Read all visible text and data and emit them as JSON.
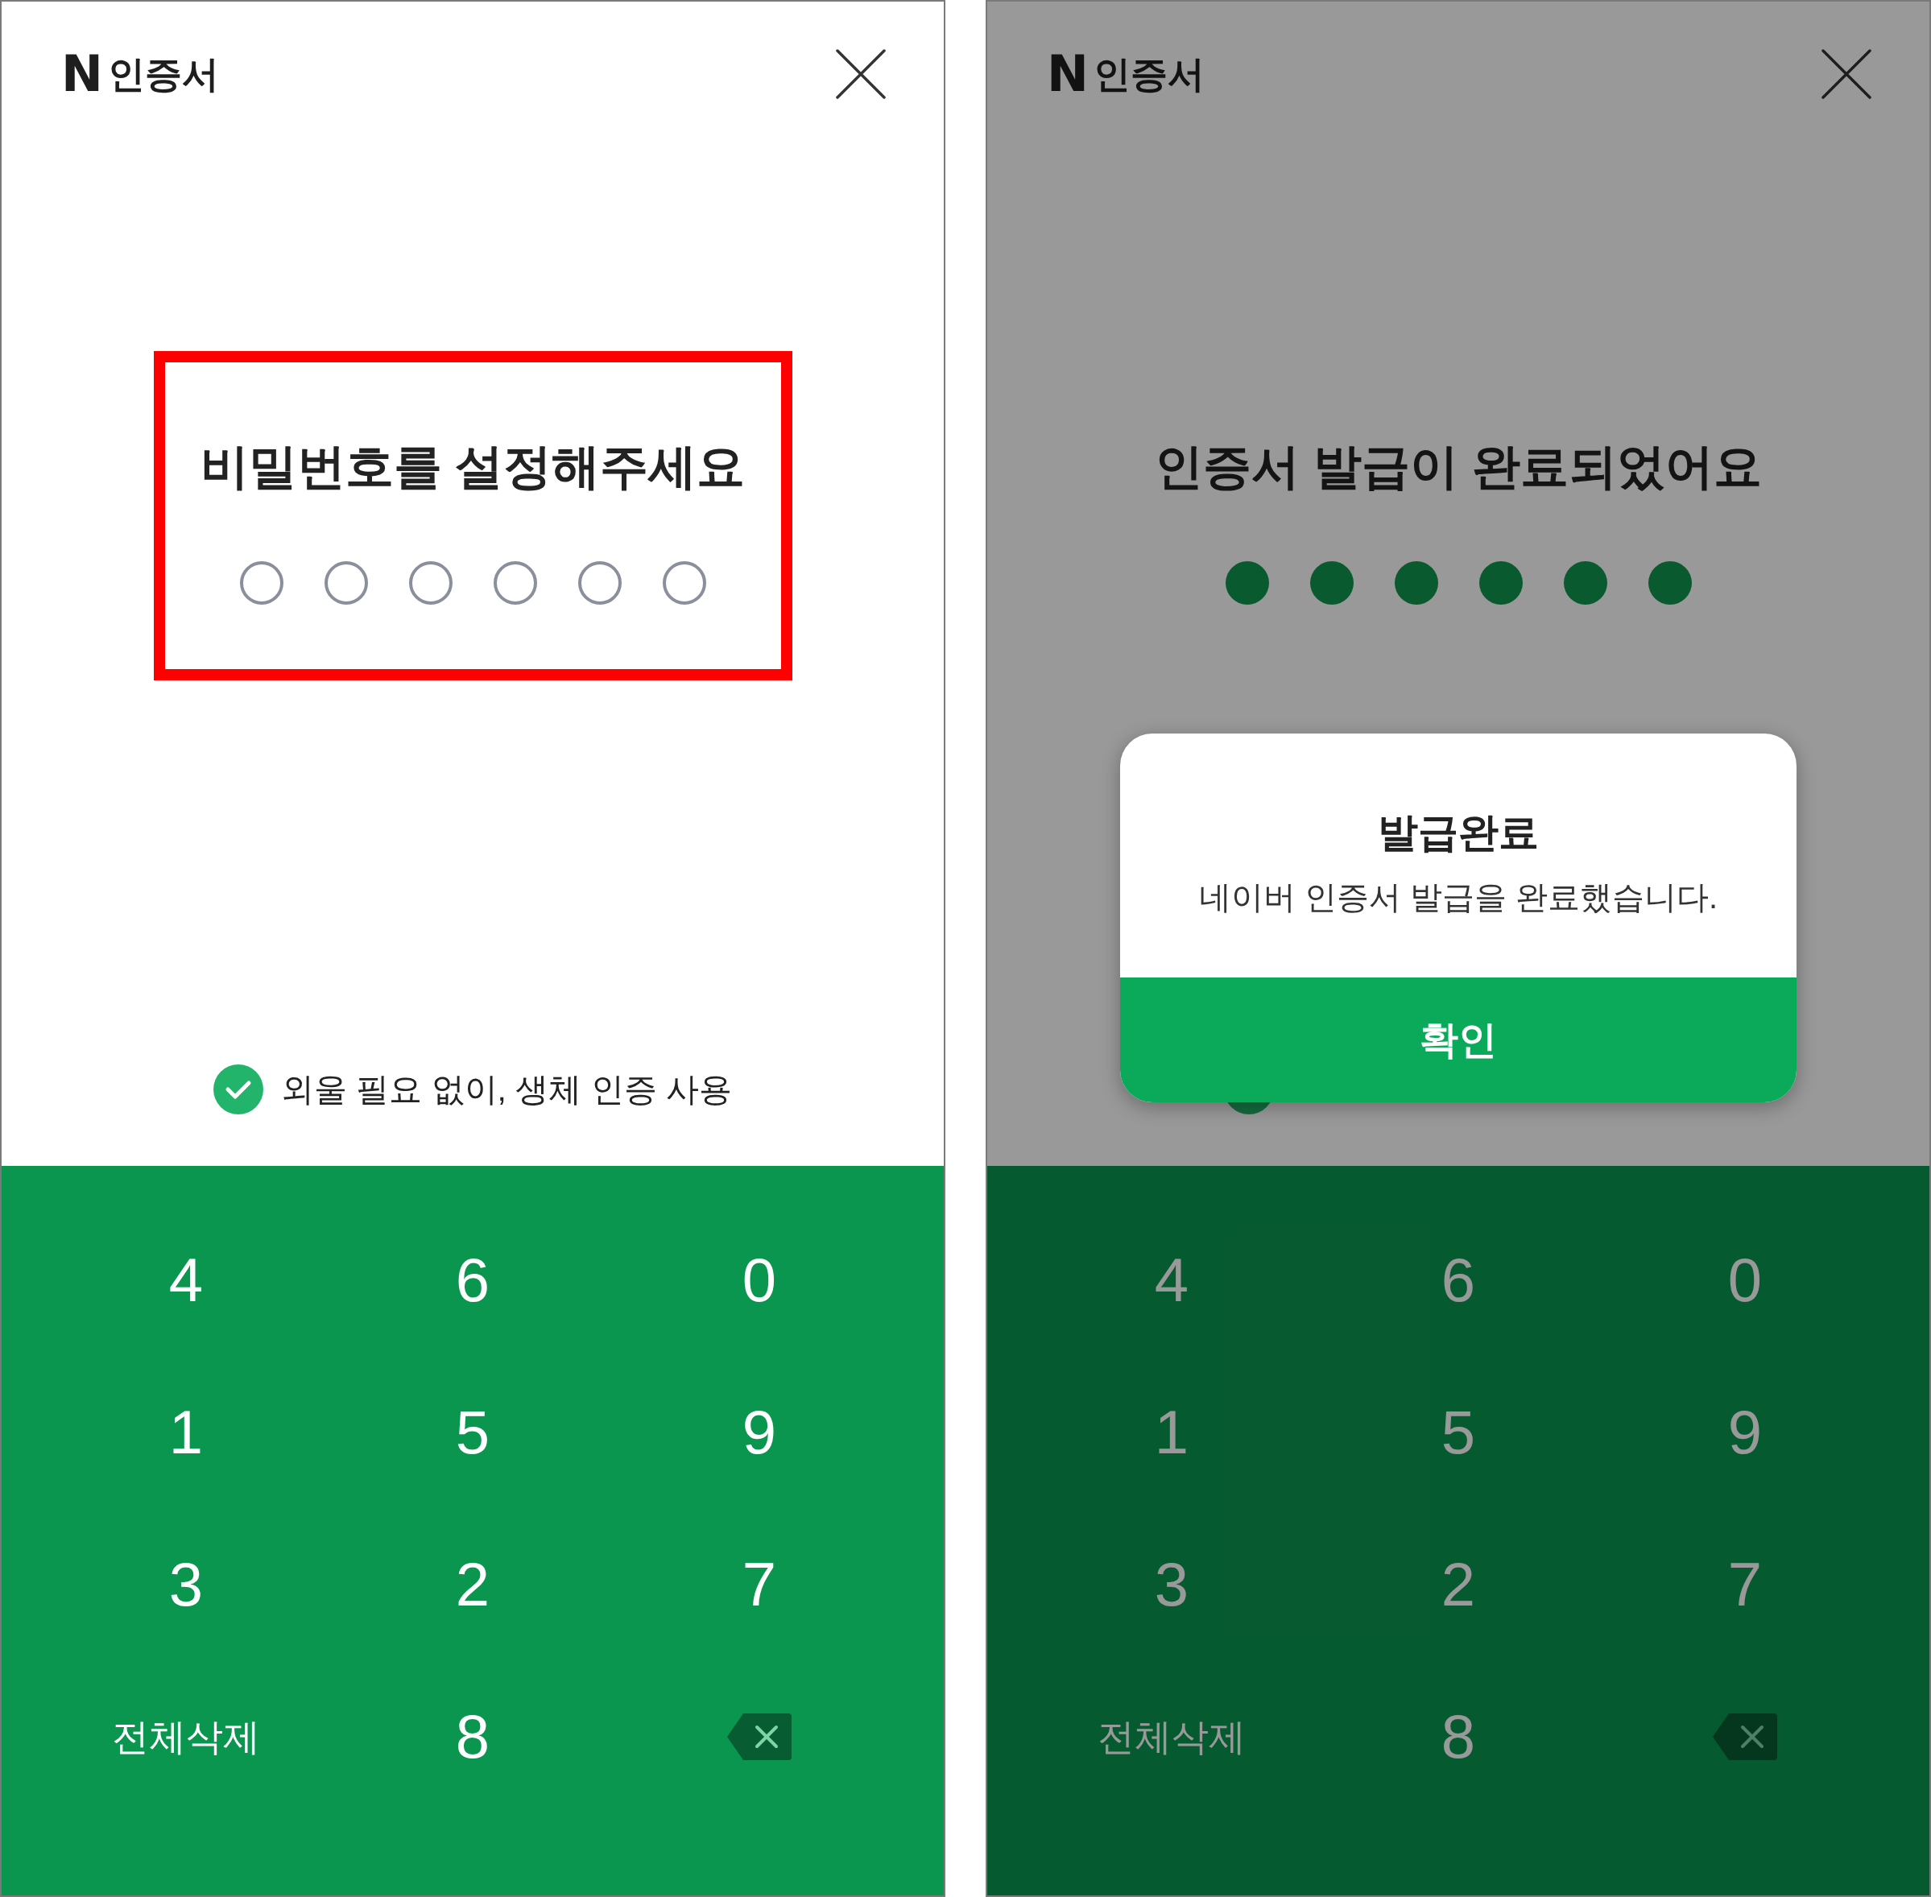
{
  "screens": [
    {
      "logo": "N",
      "brand": "인증서",
      "title": "비밀번호를 설정해주세요",
      "highlighted": true,
      "dimmed": false,
      "pin_dots": [
        {
          "filled": false
        },
        {
          "filled": false
        },
        {
          "filled": false
        },
        {
          "filled": false
        },
        {
          "filled": false
        },
        {
          "filled": false
        }
      ],
      "biometric": {
        "checked": true,
        "label": "외울 필요 없이, 생체 인증 사용"
      },
      "keypad": [
        {
          "kind": "digit",
          "label": "4"
        },
        {
          "kind": "digit",
          "label": "6"
        },
        {
          "kind": "digit",
          "label": "0"
        },
        {
          "kind": "digit",
          "label": "1"
        },
        {
          "kind": "digit",
          "label": "5"
        },
        {
          "kind": "digit",
          "label": "9"
        },
        {
          "kind": "digit",
          "label": "3"
        },
        {
          "kind": "digit",
          "label": "2"
        },
        {
          "kind": "digit",
          "label": "7"
        },
        {
          "kind": "clear",
          "label": "전체삭제"
        },
        {
          "kind": "digit",
          "label": "8"
        },
        {
          "kind": "backspace"
        }
      ]
    },
    {
      "logo": "N",
      "brand": "인증서",
      "title": "인증서 발급이 완료되었어요",
      "dimmed": true,
      "pin_dots": [
        {
          "filled": true
        },
        {
          "filled": true
        },
        {
          "filled": true
        },
        {
          "filled": true
        },
        {
          "filled": true
        },
        {
          "filled": true
        }
      ],
      "biometric": {
        "checked": true
      },
      "keypad": [
        {
          "kind": "digit",
          "label": "4"
        },
        {
          "kind": "digit",
          "label": "6"
        },
        {
          "kind": "digit",
          "label": "0"
        },
        {
          "kind": "digit",
          "label": "1"
        },
        {
          "kind": "digit",
          "label": "5"
        },
        {
          "kind": "digit",
          "label": "9"
        },
        {
          "kind": "digit",
          "label": "3"
        },
        {
          "kind": "digit",
          "label": "2"
        },
        {
          "kind": "digit",
          "label": "7"
        },
        {
          "kind": "clear",
          "label": "전체삭제"
        },
        {
          "kind": "digit",
          "label": "8"
        },
        {
          "kind": "backspace"
        }
      ],
      "dialog": {
        "title": "발급완료",
        "message": "네이버 인증서 발급을 완료했습니다.",
        "button": "확인"
      }
    }
  ]
}
